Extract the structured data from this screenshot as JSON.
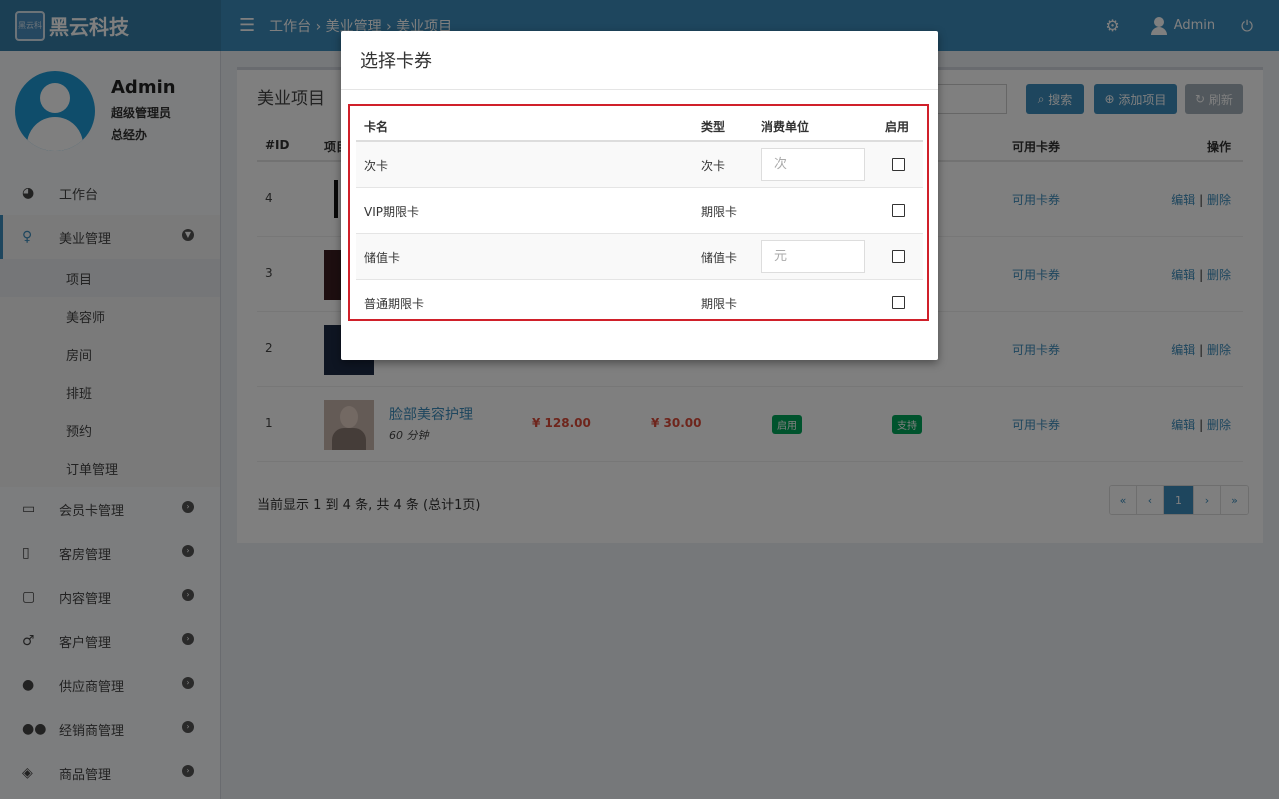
{
  "topbar": {
    "logo_text": "黑云科技",
    "brand": "黑云科技",
    "breadcrumb": "工作台 › 美业管理 › 美业项目",
    "user": "Admin"
  },
  "profile": {
    "name": "Admin",
    "role": "超级管理员",
    "dept": "总经办"
  },
  "menu": {
    "dashboard": "工作台",
    "beauty": "美业管理",
    "sub": [
      "项目",
      "美容师",
      "房间",
      "排班",
      "预约",
      "订单管理"
    ],
    "items": [
      "会员卡管理",
      "客房管理",
      "内容管理",
      "客户管理",
      "供应商管理",
      "经销商管理",
      "商品管理"
    ]
  },
  "main": {
    "title": "美业项目",
    "buttons": {
      "search": "搜索",
      "add": "添加项目",
      "refresh": "刷新"
    },
    "columns": {
      "id": "#ID",
      "project": "项目",
      "cards": "可用卡券",
      "ops": "操作"
    },
    "rows": [
      {
        "id": "4",
        "cards": "可用卡券",
        "edit": "编辑",
        "delete": "删除"
      },
      {
        "id": "3",
        "cards": "可用卡券",
        "edit": "编辑",
        "delete": "删除"
      },
      {
        "id": "2",
        "cards": "可用卡券",
        "edit": "编辑",
        "delete": "删除"
      },
      {
        "id": "1",
        "name": "脸部美容护理",
        "duration": "60 分钟",
        "price1": "¥ 128.00",
        "price2": "¥ 30.00",
        "status": "启用",
        "support": "支持",
        "cards": "可用卡券",
        "edit": "编辑",
        "delete": "删除"
      }
    ],
    "footer": "当前显示 1 到 4 条, 共 4 条 (总计1页)",
    "pager": [
      "«",
      "‹",
      "1",
      "›",
      "»"
    ]
  },
  "modal": {
    "title": "选择卡券",
    "headers": {
      "name": "卡名",
      "type": "类型",
      "unit": "消费单位",
      "enable": "启用"
    },
    "rows": [
      {
        "name": "次卡",
        "type": "次卡",
        "placeholder": "次"
      },
      {
        "name": "VIP期限卡",
        "type": "期限卡"
      },
      {
        "name": "储值卡",
        "type": "储值卡",
        "placeholder": "元"
      },
      {
        "name": "普通期限卡",
        "type": "期限卡"
      }
    ]
  },
  "colors": {
    "primary": "#3c8dbc",
    "danger": "#dd4b39",
    "success": "#00a65a",
    "highlight": "#d0202a"
  }
}
